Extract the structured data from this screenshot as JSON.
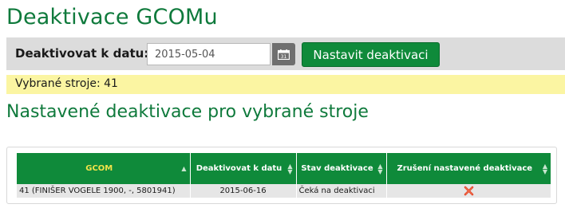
{
  "page": {
    "title": "Deaktivace GCOMu"
  },
  "toolbar": {
    "date_label": "Deaktivovat k datu:",
    "date_value": "2015-05-04",
    "calendar_icon": "calendar-icon",
    "submit_label": "Nastavit deaktivaci"
  },
  "selection": {
    "text": "Vybrané stroje: 41"
  },
  "section": {
    "title": "Nastavené deaktivace pro vybrané stroje"
  },
  "table": {
    "columns": [
      {
        "label": "GCOM",
        "sort": "asc"
      },
      {
        "label": "Deaktivovat k datu",
        "sort": "both"
      },
      {
        "label": "Stav deaktivace",
        "sort": "both"
      },
      {
        "label": "Zrušení nastavené deaktivace",
        "sort": "both"
      }
    ],
    "rows": [
      {
        "gcom": "41 (FINIŠER VOGELE 1900, -, 5801941)",
        "date": "2015-06-16",
        "status": "Čeká na deaktivaci",
        "cancel_icon": "cancel-x-icon"
      }
    ]
  },
  "colors": {
    "brand_green": "#0f8a3a",
    "title_green": "#0f7a3c",
    "highlight_yellow": "#fbf5a2",
    "cancel_red": "#e03a1e"
  }
}
